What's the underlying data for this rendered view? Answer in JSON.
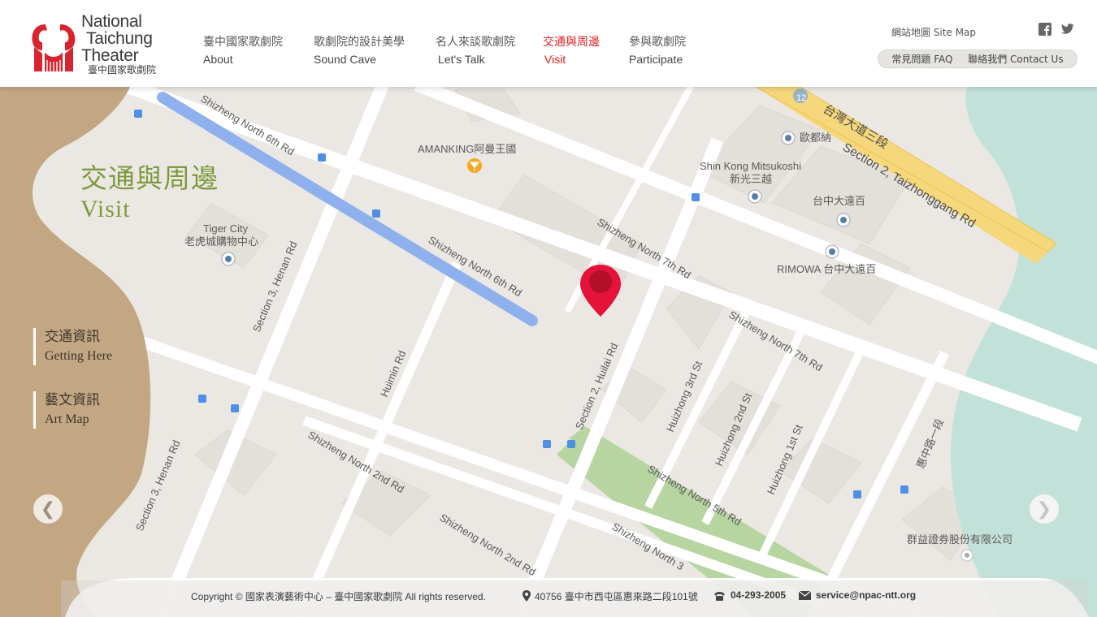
{
  "header": {
    "logo": {
      "line1": "National",
      "line2": "Taichung",
      "line3": "Theater",
      "line4": "臺中國家歌劇院"
    },
    "nav": [
      {
        "zh": "臺中國家歌劇院",
        "en": "About"
      },
      {
        "zh": "歌劇院的設計美學",
        "en": "Sound Cave"
      },
      {
        "zh": "名人來談歌劇院",
        "en": "Let's Talk"
      },
      {
        "zh": "交通與周邊",
        "en": "Visit"
      },
      {
        "zh": "參與歌劇院",
        "en": "Participate"
      }
    ],
    "sitemap": "網站地圖 Site Map",
    "faq": "常見問題 FAQ",
    "contact": "聯絡我們 Contact Us",
    "social": [
      "facebook-icon",
      "twitter-icon"
    ]
  },
  "page": {
    "title_zh": "交通與周邊",
    "title_en": "Visit"
  },
  "side_menu": [
    {
      "zh": "交通資訊",
      "en": "Getting Here"
    },
    {
      "zh": "藝文資訊",
      "en": "Art Map"
    }
  ],
  "map_labels": {
    "tiger_en": "Tiger City",
    "tiger_zh": "老虎城購物中心",
    "amanking": "AMANKING阿曼王國",
    "shinkong_en": "Shin Kong Mitsukoshi",
    "shinkong_zh": "新光三越",
    "ouduna": "歐都納",
    "dayuan": "台中大遠百",
    "rimowa": "RIMOWA 台中大遠百",
    "taiwan_blvd": "台灣大道三段",
    "taizhonggang": "Section 2, Taizhonggang Rd",
    "shizheng6_a": "Shizheng North 6th Rd",
    "shizheng6_b": "Shizheng North 6th Rd",
    "shizheng7_a": "Shizheng North 7th Rd",
    "shizheng7_b": "Shizheng North 7th Rd",
    "henan_a": "Section 3, Henan Rd",
    "henan_b": "Section 3, Henan Rd",
    "huimin": "Huimin Rd",
    "huilai": "Section 2, Huilai Rd",
    "huizhong3": "Huizhong 3rd St",
    "huizhong2": "Huizhong 2nd St",
    "huizhong1": "Huizhong 1st St",
    "shizheng2_a": "Shizheng North 2nd Rd",
    "shizheng2_b": "Shizheng North 2nd Rd",
    "shizheng5": "Shizheng North 5th Rd",
    "shizheng3": "Shizheng North 3",
    "huizhong_rd": "惠中路一段",
    "qunyi": "群益證券股份有限公司",
    "route12": "12"
  },
  "footer": {
    "copyright": "Copyright © 國家表演藝術中心 – 臺中國家歌劇院 All rights reserved.",
    "address": "40756 臺中市西屯區惠來路二段101號",
    "phone": "04-293-2005",
    "email": "service@npac-ntt.org"
  },
  "colors": {
    "accent_red": "#e02020",
    "title_green": "#7f9a3d",
    "tan": "#c3a783",
    "water": "#c2e1d8"
  }
}
